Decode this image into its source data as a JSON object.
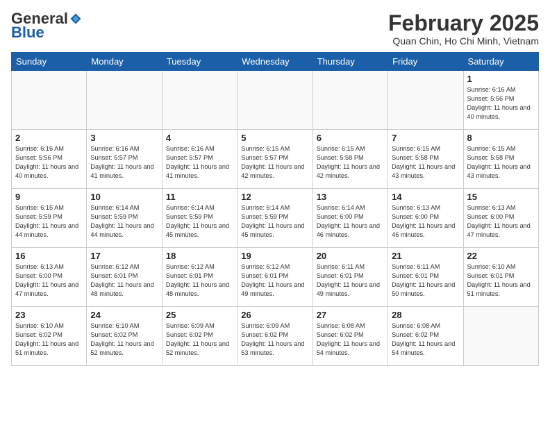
{
  "header": {
    "logo_general": "General",
    "logo_blue": "Blue",
    "month_year": "February 2025",
    "location": "Quan Chin, Ho Chi Minh, Vietnam"
  },
  "calendar": {
    "days_of_week": [
      "Sunday",
      "Monday",
      "Tuesday",
      "Wednesday",
      "Thursday",
      "Friday",
      "Saturday"
    ],
    "weeks": [
      [
        {
          "day": "",
          "sunrise": "",
          "sunset": "",
          "daylight": "",
          "empty": true
        },
        {
          "day": "",
          "sunrise": "",
          "sunset": "",
          "daylight": "",
          "empty": true
        },
        {
          "day": "",
          "sunrise": "",
          "sunset": "",
          "daylight": "",
          "empty": true
        },
        {
          "day": "",
          "sunrise": "",
          "sunset": "",
          "daylight": "",
          "empty": true
        },
        {
          "day": "",
          "sunrise": "",
          "sunset": "",
          "daylight": "",
          "empty": true
        },
        {
          "day": "",
          "sunrise": "",
          "sunset": "",
          "daylight": "",
          "empty": true
        },
        {
          "day": "1",
          "sunrise": "Sunrise: 6:16 AM",
          "sunset": "Sunset: 5:56 PM",
          "daylight": "Daylight: 11 hours and 40 minutes."
        }
      ],
      [
        {
          "day": "2",
          "sunrise": "Sunrise: 6:16 AM",
          "sunset": "Sunset: 5:56 PM",
          "daylight": "Daylight: 11 hours and 40 minutes."
        },
        {
          "day": "3",
          "sunrise": "Sunrise: 6:16 AM",
          "sunset": "Sunset: 5:57 PM",
          "daylight": "Daylight: 11 hours and 41 minutes."
        },
        {
          "day": "4",
          "sunrise": "Sunrise: 6:16 AM",
          "sunset": "Sunset: 5:57 PM",
          "daylight": "Daylight: 11 hours and 41 minutes."
        },
        {
          "day": "5",
          "sunrise": "Sunrise: 6:15 AM",
          "sunset": "Sunset: 5:57 PM",
          "daylight": "Daylight: 11 hours and 42 minutes."
        },
        {
          "day": "6",
          "sunrise": "Sunrise: 6:15 AM",
          "sunset": "Sunset: 5:58 PM",
          "daylight": "Daylight: 11 hours and 42 minutes."
        },
        {
          "day": "7",
          "sunrise": "Sunrise: 6:15 AM",
          "sunset": "Sunset: 5:58 PM",
          "daylight": "Daylight: 11 hours and 43 minutes."
        },
        {
          "day": "8",
          "sunrise": "Sunrise: 6:15 AM",
          "sunset": "Sunset: 5:58 PM",
          "daylight": "Daylight: 11 hours and 43 minutes."
        }
      ],
      [
        {
          "day": "9",
          "sunrise": "Sunrise: 6:15 AM",
          "sunset": "Sunset: 5:59 PM",
          "daylight": "Daylight: 11 hours and 44 minutes."
        },
        {
          "day": "10",
          "sunrise": "Sunrise: 6:14 AM",
          "sunset": "Sunset: 5:59 PM",
          "daylight": "Daylight: 11 hours and 44 minutes."
        },
        {
          "day": "11",
          "sunrise": "Sunrise: 6:14 AM",
          "sunset": "Sunset: 5:59 PM",
          "daylight": "Daylight: 11 hours and 45 minutes."
        },
        {
          "day": "12",
          "sunrise": "Sunrise: 6:14 AM",
          "sunset": "Sunset: 5:59 PM",
          "daylight": "Daylight: 11 hours and 45 minutes."
        },
        {
          "day": "13",
          "sunrise": "Sunrise: 6:14 AM",
          "sunset": "Sunset: 6:00 PM",
          "daylight": "Daylight: 11 hours and 46 minutes."
        },
        {
          "day": "14",
          "sunrise": "Sunrise: 6:13 AM",
          "sunset": "Sunset: 6:00 PM",
          "daylight": "Daylight: 11 hours and 46 minutes."
        },
        {
          "day": "15",
          "sunrise": "Sunrise: 6:13 AM",
          "sunset": "Sunset: 6:00 PM",
          "daylight": "Daylight: 11 hours and 47 minutes."
        }
      ],
      [
        {
          "day": "16",
          "sunrise": "Sunrise: 6:13 AM",
          "sunset": "Sunset: 6:00 PM",
          "daylight": "Daylight: 11 hours and 47 minutes."
        },
        {
          "day": "17",
          "sunrise": "Sunrise: 6:12 AM",
          "sunset": "Sunset: 6:01 PM",
          "daylight": "Daylight: 11 hours and 48 minutes."
        },
        {
          "day": "18",
          "sunrise": "Sunrise: 6:12 AM",
          "sunset": "Sunset: 6:01 PM",
          "daylight": "Daylight: 11 hours and 48 minutes."
        },
        {
          "day": "19",
          "sunrise": "Sunrise: 6:12 AM",
          "sunset": "Sunset: 6:01 PM",
          "daylight": "Daylight: 11 hours and 49 minutes."
        },
        {
          "day": "20",
          "sunrise": "Sunrise: 6:11 AM",
          "sunset": "Sunset: 6:01 PM",
          "daylight": "Daylight: 11 hours and 49 minutes."
        },
        {
          "day": "21",
          "sunrise": "Sunrise: 6:11 AM",
          "sunset": "Sunset: 6:01 PM",
          "daylight": "Daylight: 11 hours and 50 minutes."
        },
        {
          "day": "22",
          "sunrise": "Sunrise: 6:10 AM",
          "sunset": "Sunset: 6:01 PM",
          "daylight": "Daylight: 11 hours and 51 minutes."
        }
      ],
      [
        {
          "day": "23",
          "sunrise": "Sunrise: 6:10 AM",
          "sunset": "Sunset: 6:02 PM",
          "daylight": "Daylight: 11 hours and 51 minutes."
        },
        {
          "day": "24",
          "sunrise": "Sunrise: 6:10 AM",
          "sunset": "Sunset: 6:02 PM",
          "daylight": "Daylight: 11 hours and 52 minutes."
        },
        {
          "day": "25",
          "sunrise": "Sunrise: 6:09 AM",
          "sunset": "Sunset: 6:02 PM",
          "daylight": "Daylight: 11 hours and 52 minutes."
        },
        {
          "day": "26",
          "sunrise": "Sunrise: 6:09 AM",
          "sunset": "Sunset: 6:02 PM",
          "daylight": "Daylight: 11 hours and 53 minutes."
        },
        {
          "day": "27",
          "sunrise": "Sunrise: 6:08 AM",
          "sunset": "Sunset: 6:02 PM",
          "daylight": "Daylight: 11 hours and 54 minutes."
        },
        {
          "day": "28",
          "sunrise": "Sunrise: 6:08 AM",
          "sunset": "Sunset: 6:02 PM",
          "daylight": "Daylight: 11 hours and 54 minutes."
        },
        {
          "day": "",
          "sunrise": "",
          "sunset": "",
          "daylight": "",
          "empty": true
        }
      ]
    ]
  }
}
